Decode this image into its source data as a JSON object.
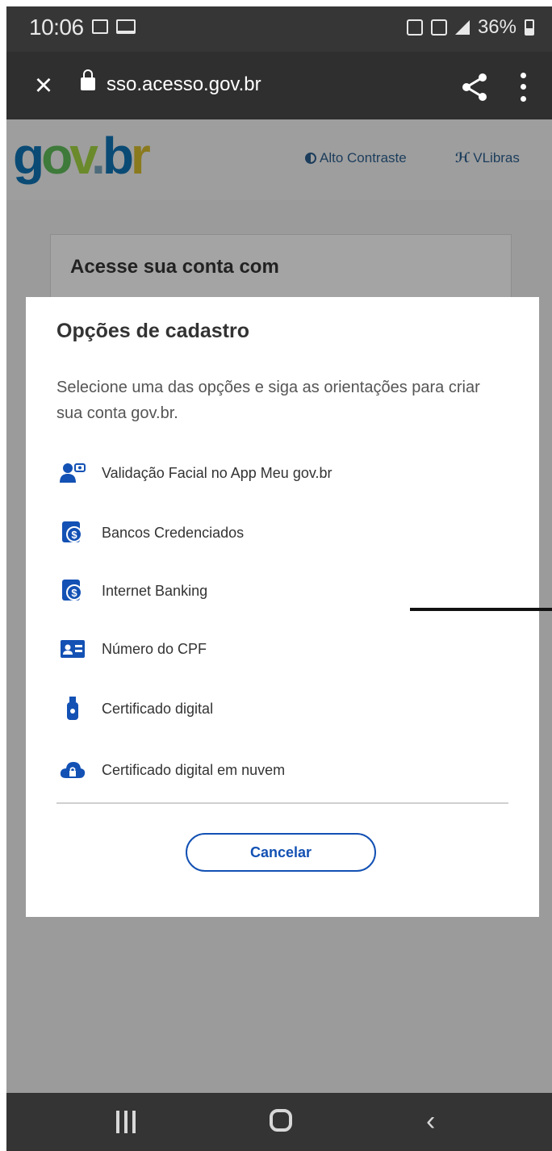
{
  "status_bar": {
    "time": "10:06",
    "battery": "36%"
  },
  "browser": {
    "url": "sso.acesso.gov.br",
    "close_icon": "×"
  },
  "header": {
    "logo_parts": [
      "g",
      "o",
      "v",
      ".",
      "b",
      "r"
    ],
    "contrast_label": "Alto Contraste",
    "vlibras_label": "VLibras",
    "vlibras_glyph": "ℋ"
  },
  "background_card": {
    "title": "Acesse sua conta com"
  },
  "modal": {
    "title": "Opções de cadastro",
    "description": "Selecione uma das opções e siga as orientações para criar sua conta gov.br.",
    "options": [
      {
        "label": "Validação Facial no App Meu gov.br",
        "icon": "face-id-icon"
      },
      {
        "label": "Bancos Credenciados",
        "icon": "bank-icon"
      },
      {
        "label": "Internet Banking",
        "icon": "bank-icon"
      },
      {
        "label": "Número do CPF",
        "icon": "id-card-icon"
      },
      {
        "label": "Certificado digital",
        "icon": "usb-token-icon"
      },
      {
        "label": "Certificado digital em nuvem",
        "icon": "cloud-icon"
      }
    ],
    "cancel_label": "Cancelar"
  },
  "colors": {
    "primary_blue": "#1351b4",
    "overlay_gray": "#9b9b9b",
    "icon_blue": "#1351b4"
  }
}
